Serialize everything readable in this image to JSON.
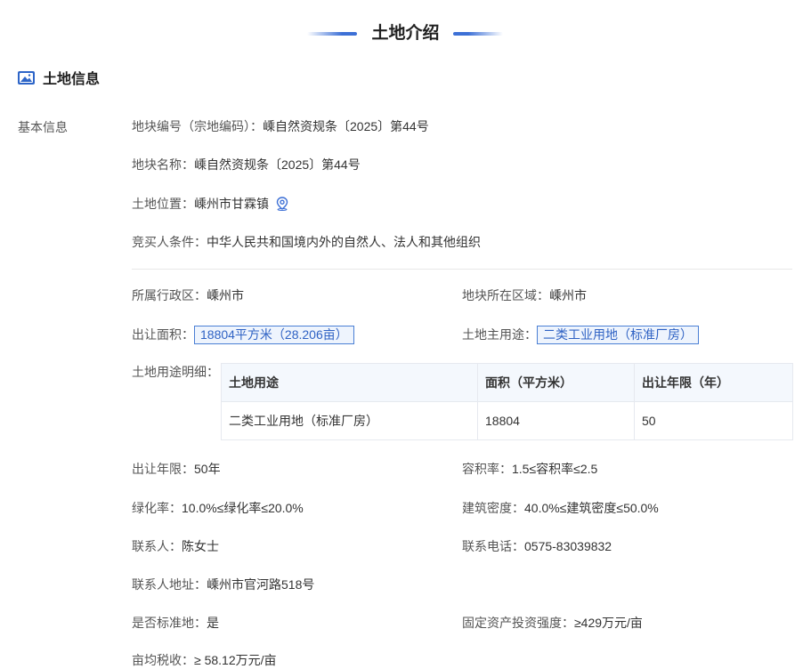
{
  "header": {
    "title": "土地介绍"
  },
  "section": {
    "title": "土地信息",
    "icon": "image-icon"
  },
  "basic_label": "基本信息",
  "parcel_no": {
    "label": "地块编号（宗地编码）：",
    "value": "嵊自然资规条〔2025〕第44号"
  },
  "parcel_name": {
    "label": "地块名称：",
    "value": "嵊自然资规条〔2025〕第44号"
  },
  "location": {
    "label": "土地位置：",
    "value": "嵊州市甘霖镇",
    "icon": "location-pin-icon"
  },
  "bidder_condition": {
    "label": "竞买人条件：",
    "value": "中华人民共和国境内外的自然人、法人和其他组织"
  },
  "admin_region": {
    "label": "所属行政区：",
    "value": "嵊州市"
  },
  "parcel_area_region": {
    "label": "地块所在区域：",
    "value": "嵊州市"
  },
  "transfer_area": {
    "label": "出让面积：",
    "value": "18804平方米（28.206亩）"
  },
  "main_use": {
    "label": "土地主用途：",
    "value": "二类工业用地（标准厂房）"
  },
  "use_detail": {
    "label": "土地用途明细：",
    "headers": [
      "土地用途",
      "面积（平方米）",
      "出让年限（年）"
    ],
    "rows": [
      [
        "二类工业用地（标准厂房）",
        "18804",
        "50"
      ]
    ]
  },
  "transfer_years": {
    "label": "出让年限：",
    "value": "50年"
  },
  "plot_ratio": {
    "label": "容积率：",
    "value": "1.5≤容积率≤2.5"
  },
  "green_ratio": {
    "label": "绿化率：",
    "value": "10.0%≤绿化率≤20.0%"
  },
  "building_density": {
    "label": "建筑密度：",
    "value": "40.0%≤建筑密度≤50.0%"
  },
  "contact": {
    "label": "联系人：",
    "value": "陈女士"
  },
  "phone": {
    "label": "联系电话：",
    "value": "0575-83039832"
  },
  "contact_address": {
    "label": "联系人地址：",
    "value": "嵊州市官河路518号"
  },
  "standard_land": {
    "label": "是否标准地：",
    "value": "是"
  },
  "investment_intensity": {
    "label": "固定资产投资强度：",
    "value": "≥429万元/亩"
  },
  "tax_per_mu": {
    "label": "亩均税收：",
    "value": "≥ 58.12万元/亩"
  },
  "colors": {
    "accent": "#3d70d6",
    "tag_border": "#4a7fd4",
    "tag_text": "#2f62c4"
  }
}
